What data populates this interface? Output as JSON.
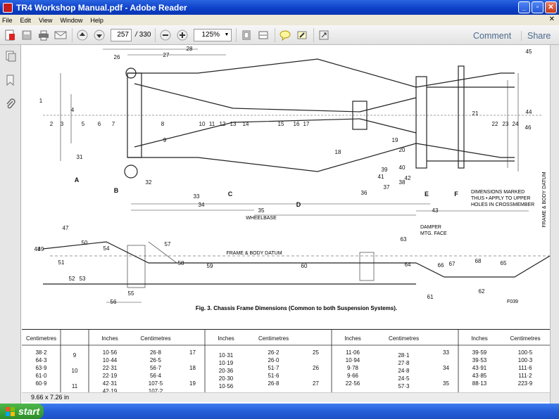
{
  "window": {
    "title": "TR4  Workshop Manual.pdf - Adobe Reader"
  },
  "menu": [
    "File",
    "Edit",
    "View",
    "Window",
    "Help"
  ],
  "toolbar": {
    "page_current": "257",
    "page_sep": "/",
    "page_total": "330",
    "zoom": "125%",
    "comment_label": "Comment",
    "share_label": "Share"
  },
  "document": {
    "page_size_label": "9.66 x 7.26 in",
    "caption": "Fig. 3.  Chassis Frame Dimensions (Common to both Suspension Systems).",
    "figure_code": "F039",
    "wheelbase_label": "WHEELBASE",
    "datum_label": "FRAME & BODY DATUM",
    "damper_label": "DAMPER",
    "damper_label2": "MTG. FACE",
    "marked_note1": "DIMENSIONS MARKED",
    "marked_note2": "THUS • APPLY TO UPPER",
    "marked_note3": "HOLES IN CROSSMEMBER",
    "side_label": "FRAME & BODY DATUM",
    "letters": [
      "A",
      "B",
      "C",
      "D",
      "E",
      "F"
    ],
    "table": {
      "headers": [
        "Centimetres",
        "",
        "Inches",
        "Centimetres",
        "",
        "Inches",
        "Centimetres",
        "",
        "Inches",
        "Centimetres",
        "",
        "Inches",
        "Centimetres"
      ],
      "rows": [
        [
          "38·2",
          "9",
          "10·56",
          "26·8",
          "17",
          "10·31",
          "26·2",
          "25",
          "11·06",
          "28·1",
          "33",
          "39·59",
          "100·5"
        ],
        [
          "64·3",
          "",
          "10·44",
          "26·5",
          "",
          "10·19",
          "26·0",
          "",
          "10·94",
          "27·8",
          "",
          "39·53",
          "100·3"
        ],
        [
          "63·9",
          "10",
          "22·31",
          "56·7",
          "18",
          "20·36",
          "51·7",
          "26",
          "9·78",
          "24·8",
          "34",
          "43·91",
          "111·6"
        ],
        [
          "61·0",
          "",
          "22·19",
          "56·4",
          "",
          "20·30",
          "51·6",
          "",
          "9·66",
          "24·5",
          "",
          "43·85",
          "111·2"
        ],
        [
          "60·9",
          "11",
          "42·31",
          "107·5",
          "19",
          "10·56",
          "26·8",
          "27",
          "22·56",
          "57·3",
          "35",
          "88·13",
          "223·9"
        ],
        [
          "",
          "",
          "42·19",
          "107·2",
          "",
          "",
          "",
          "",
          "",
          "",
          "",
          "",
          ""
        ]
      ]
    }
  },
  "taskbar": {
    "start_label": "start"
  },
  "colors": {
    "titlebar": "#0b3fc7",
    "taskbar": "#245ed8",
    "start": "#2c8e2a",
    "close": "#c43b1a"
  }
}
